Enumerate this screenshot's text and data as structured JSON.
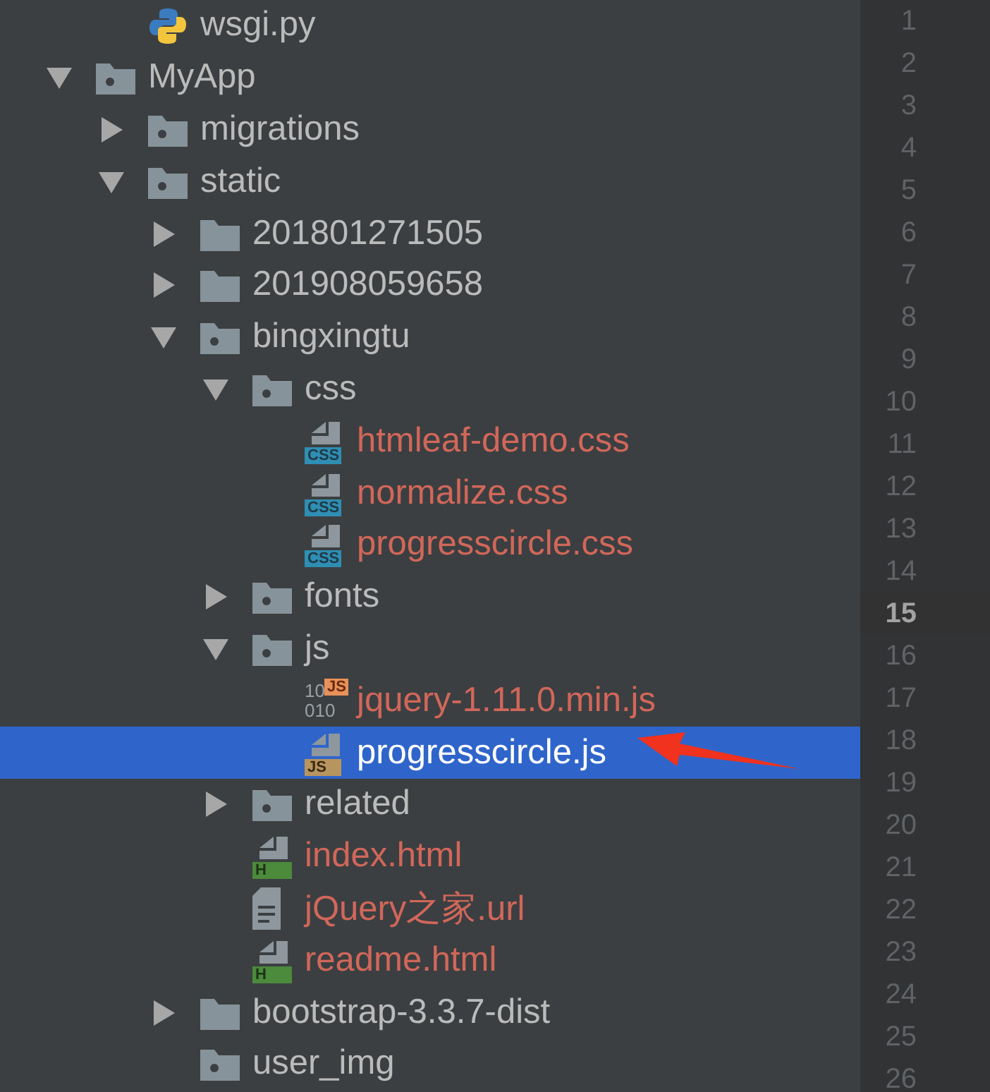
{
  "partial_row": {
    "name": "wsgi.py",
    "kind": "python",
    "untracked": false,
    "selected": false
  },
  "tree": [
    {
      "name": "MyApp",
      "kind": "package",
      "expanded": true,
      "selected": false,
      "children": [
        {
          "name": "migrations",
          "kind": "package",
          "expanded": false,
          "selected": false
        },
        {
          "name": "static",
          "kind": "package",
          "expanded": true,
          "selected": false,
          "children": [
            {
              "name": "201801271505",
              "kind": "folder",
              "expanded": false,
              "selected": false
            },
            {
              "name": "201908059658",
              "kind": "folder",
              "expanded": false,
              "selected": false
            },
            {
              "name": "bingxingtu",
              "kind": "package",
              "expanded": true,
              "selected": false,
              "children": [
                {
                  "name": "css",
                  "kind": "package",
                  "expanded": true,
                  "selected": false,
                  "children": [
                    {
                      "name": "htmleaf-demo.css",
                      "kind": "css",
                      "badge": "CSS",
                      "untracked": true,
                      "selected": false
                    },
                    {
                      "name": "normalize.css",
                      "kind": "css",
                      "badge": "CSS",
                      "untracked": true,
                      "selected": false
                    },
                    {
                      "name": "progresscircle.css",
                      "kind": "css",
                      "badge": "CSS",
                      "untracked": true,
                      "selected": false
                    }
                  ]
                },
                {
                  "name": "fonts",
                  "kind": "package",
                  "expanded": false,
                  "selected": false
                },
                {
                  "name": "js",
                  "kind": "package",
                  "expanded": true,
                  "selected": false,
                  "children": [
                    {
                      "name": "jquery-1.11.0.min.js",
                      "kind": "minjs",
                      "badge": "JS",
                      "glyph": [
                        "10",
                        "010"
                      ],
                      "untracked": true,
                      "selected": false
                    },
                    {
                      "name": "progresscircle.js",
                      "kind": "js",
                      "badge": "JS",
                      "untracked": true,
                      "selected": true
                    }
                  ]
                },
                {
                  "name": "related",
                  "kind": "package",
                  "expanded": false,
                  "selected": false
                },
                {
                  "name": "index.html",
                  "kind": "html",
                  "badge": "H",
                  "untracked": true,
                  "selected": false
                },
                {
                  "name": "jQuery之家.url",
                  "kind": "url",
                  "untracked": true,
                  "selected": false
                },
                {
                  "name": "readme.html",
                  "kind": "html",
                  "badge": "H",
                  "untracked": true,
                  "selected": false
                }
              ]
            },
            {
              "name": "bootstrap-3.3.7-dist",
              "kind": "folder",
              "expanded": false,
              "selected": false
            },
            {
              "name": "user_img",
              "kind": "package",
              "selected": false
            }
          ]
        }
      ]
    }
  ],
  "gutter": [
    {
      "n": "1",
      "current": false
    },
    {
      "n": "2",
      "current": false
    },
    {
      "n": "3",
      "current": false
    },
    {
      "n": "4",
      "current": false
    },
    {
      "n": "5",
      "current": false
    },
    {
      "n": "6",
      "current": false
    },
    {
      "n": "7",
      "current": false
    },
    {
      "n": "8",
      "current": false
    },
    {
      "n": "9",
      "current": false
    },
    {
      "n": "10",
      "current": false
    },
    {
      "n": "11",
      "current": false
    },
    {
      "n": "12",
      "current": false
    },
    {
      "n": "13",
      "current": false
    },
    {
      "n": "14",
      "current": false
    },
    {
      "n": "15",
      "current": true
    },
    {
      "n": "16",
      "current": false
    },
    {
      "n": "17",
      "current": false
    },
    {
      "n": "18",
      "current": false
    },
    {
      "n": "19",
      "current": false
    },
    {
      "n": "20",
      "current": false
    },
    {
      "n": "21",
      "current": false
    },
    {
      "n": "22",
      "current": false
    },
    {
      "n": "23",
      "current": false
    },
    {
      "n": "24",
      "current": false
    },
    {
      "n": "25",
      "current": false
    },
    {
      "n": "26",
      "current": false
    }
  ]
}
